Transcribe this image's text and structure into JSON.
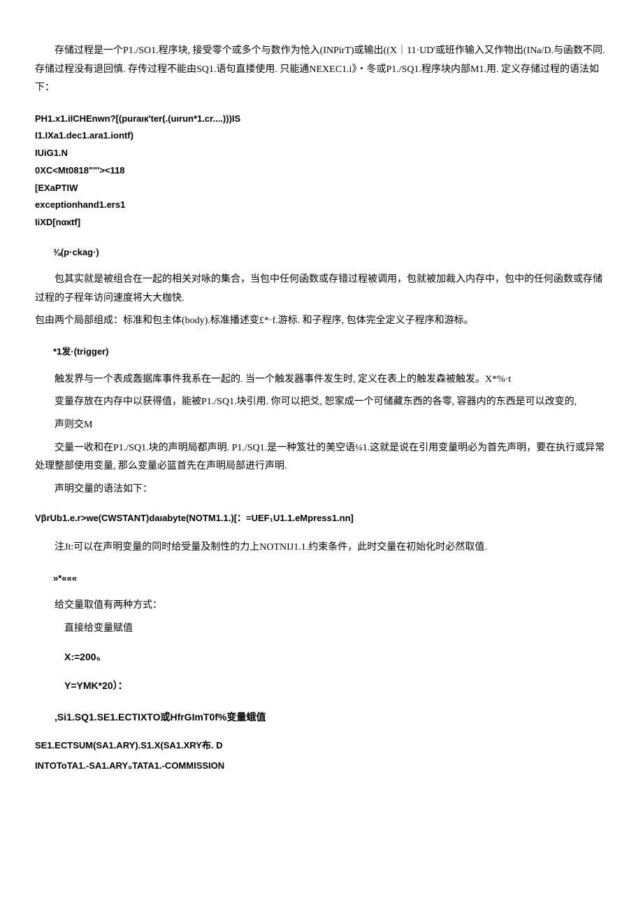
{
  "p1": "存储过程是一个P1./SO1.程序块, 接受零个或多个与数作为怆入(INPirT)或输出((X｜11·UD'或班作输入又作物出(INa/D.与函数不同. 存储过程没有退回慎. 存传过程不能由SQ1.语句直搂使用. 只能通NEXEC1.i》・冬或P1./SQ1.程序块内部M1.用. 定义存储过程的语法如下：",
  "code1_l1": "PH1.x1.iICHEnwn?[(puraıк'ter(.(uırun*1.cr....)))IS",
  "code1_l2": "I1.IXa1.dec1.ara1.iontf)",
  "code1_l3": "IUiG1.N",
  "code1_l4": "0XC<Mt0818\"\"'><118",
  "code1_l5": "[EXaPTIW",
  "code1_l6": "exceptionhand1.ers1",
  "code1_l7": "IiXD[nαкtf]",
  "h1": "⅜(p·ckag·)",
  "p2": "包其实就是被组合在一起的相关对咏的集合，当包中任何函数或存错过程被调用，包就被加裁入内存中，包中的任何函数或存储过程的子程年访问速度将大大枷快.",
  "p3": "包由两个局部组成：标准和包主体(body).标准播述变£*·f.游标. 和子程序, 包体完全定义子程序和游标。",
  "h2": "*1发·(trigger)",
  "p4": "触发界与一个表成轰据库事件我系在一起的. 当一个触发器事件发生时, 定义在表上的触发森被触发。X*%·t",
  "p5": "变量存放在内存中以获得值，能被P1./SQ1.块引用. 你可以把爻, 恕家成一个可储藏东西的各零, 容器内的东西是可以改变的,",
  "p6": "声则交M",
  "p7": "交量一收和在P1./SQ1.块的声明局都声明. P1./SQ1.是一种笈壮的美空语¼1.这就是说在引用变量明必为首先声明，要在执行或异常处理整部使用变量, 那么变量必篮首先在声明局部进行声明.",
  "p8": "声明交量的语法如下：",
  "code2": "VβrUb1.e.r>we(CWSTANT)daıabyte(NOTM1.1.)[：=UEF₁U1.1.eMpress1.nn]",
  "p9": "注Jt:可以在声明变量的同时给受量及制性的力上NOTNIJ1.1.约束条件，此时交量在初始化时必然取值.",
  "h3": "»*«««",
  "p10": "给交量取值有两种方式：",
  "p11": "直接给变量赋值",
  "p12": "X:=200₅",
  "p13": "Y=YMK*20）：",
  "p14": ",Si1.SQ1.SE1.ECTIXTO或HfrGImT0f%变量蛾值",
  "sql1": "SE1.ECTSUM(SA1.ARY).S1.X(SA1.XRY布. D",
  "sql2": "INTOToTA1.-SA1.ARY₀TATA1.-COMMISSION"
}
